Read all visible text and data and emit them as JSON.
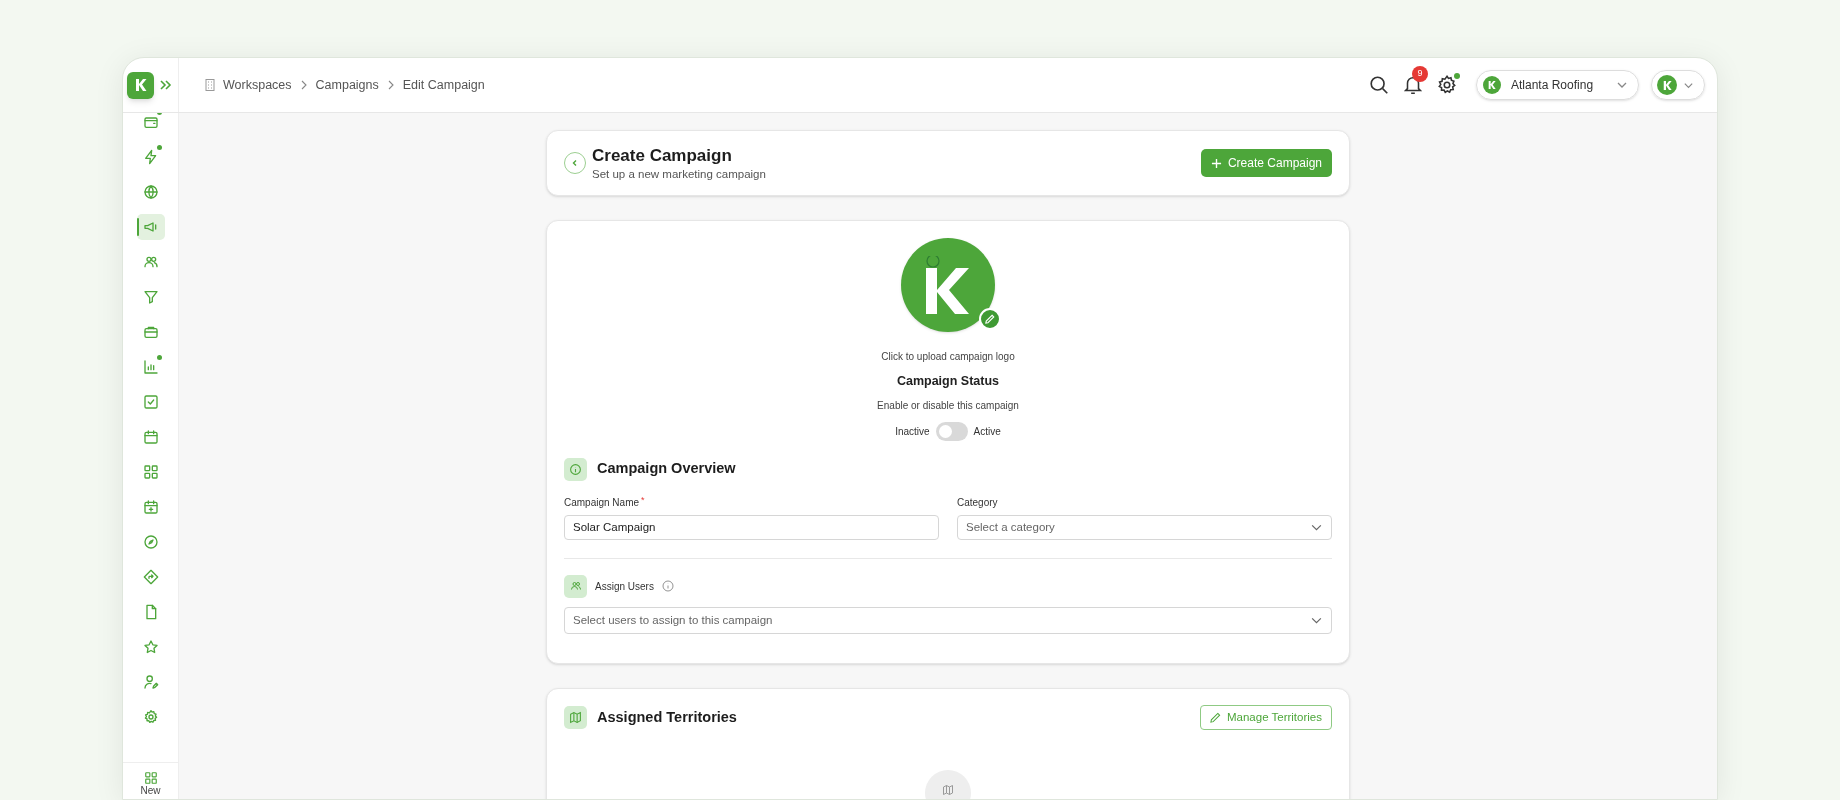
{
  "sidebar": {
    "items": [
      {
        "selected": false,
        "badge": true
      },
      {
        "selected": false,
        "badge": true
      },
      {
        "selected": false,
        "badge": false
      },
      {
        "selected": true,
        "badge": false
      },
      {
        "selected": false,
        "badge": false
      },
      {
        "selected": false,
        "badge": false
      },
      {
        "selected": false,
        "badge": false
      },
      {
        "selected": false,
        "badge": true
      },
      {
        "selected": false,
        "badge": false
      },
      {
        "selected": false,
        "badge": false
      },
      {
        "selected": false,
        "badge": false
      },
      {
        "selected": false,
        "badge": false
      },
      {
        "selected": false,
        "badge": false
      },
      {
        "selected": false,
        "badge": false
      },
      {
        "selected": false,
        "badge": false
      },
      {
        "selected": false,
        "badge": false
      },
      {
        "selected": false,
        "badge": false
      },
      {
        "selected": false,
        "badge": false
      }
    ],
    "new_label": "New"
  },
  "breadcrumbs": [
    "Workspaces",
    "Campaigns",
    "Edit Campaign"
  ],
  "top_bar": {
    "notification_count": "9",
    "settings_badge": true,
    "workspace": "Atlanta Roofing"
  },
  "header": {
    "title": "Create Campaign",
    "subtitle": "Set up a new marketing campaign",
    "button": "Create Campaign"
  },
  "logo": {
    "caption": "Click to upload campaign logo"
  },
  "status": {
    "title": "Campaign Status",
    "description": "Enable or disable this campaign",
    "off_label": "Inactive",
    "on_label": "Active",
    "on": false
  },
  "overview": {
    "title": "Campaign Overview",
    "fields": [
      {
        "kind": "text",
        "label": "Campaign Name",
        "required_mark": "*",
        "value": "Solar Campaign"
      },
      {
        "kind": "select",
        "label": "Category",
        "placeholder": "Select a category"
      }
    ]
  },
  "assign_users": {
    "label": "Assign Users",
    "placeholder": "Select users to assign to this campaign"
  },
  "territories": {
    "title": "Assigned Territories",
    "button": "Manage Territories"
  }
}
